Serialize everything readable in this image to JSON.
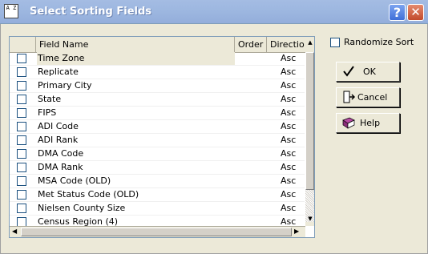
{
  "window": {
    "title": "Select Sorting Fields",
    "icon_text": "A Z",
    "help_button": "?",
    "close_button": "✕"
  },
  "table": {
    "headers": {
      "field": "Field Name",
      "order": "Order",
      "direction": "Directio"
    },
    "rows": [
      {
        "field": "Time Zone",
        "order": "",
        "direction": "Asc",
        "checked": false,
        "selected": true
      },
      {
        "field": "Replicate",
        "order": "",
        "direction": "Asc",
        "checked": false
      },
      {
        "field": "Primary City",
        "order": "",
        "direction": "Asc",
        "checked": false
      },
      {
        "field": "State",
        "order": "",
        "direction": "Asc",
        "checked": false
      },
      {
        "field": "FIPS",
        "order": "",
        "direction": "Asc",
        "checked": false
      },
      {
        "field": "ADI Code",
        "order": "",
        "direction": "Asc",
        "checked": false
      },
      {
        "field": "ADI Rank",
        "order": "",
        "direction": "Asc",
        "checked": false
      },
      {
        "field": "DMA Code",
        "order": "",
        "direction": "Asc",
        "checked": false
      },
      {
        "field": "DMA Rank",
        "order": "",
        "direction": "Asc",
        "checked": false
      },
      {
        "field": "MSA Code (OLD)",
        "order": "",
        "direction": "Asc",
        "checked": false
      },
      {
        "field": "Met Status Code (OLD)",
        "order": "",
        "direction": "Asc",
        "checked": false
      },
      {
        "field": "Nielsen County Size",
        "order": "",
        "direction": "Asc",
        "checked": false
      },
      {
        "field": "Census Region (4)",
        "order": "",
        "direction": "Asc",
        "checked": false
      }
    ]
  },
  "options": {
    "randomize_label": "Randomize Sort",
    "randomize_checked": false
  },
  "buttons": {
    "ok": "OK",
    "cancel": "Cancel",
    "help": "Help"
  },
  "icons": {
    "ok": "checkmark-icon",
    "cancel": "exit-door-icon",
    "help": "help-book-icon"
  },
  "colors": {
    "title_bar": "#9DB7E0",
    "dialog_bg": "#ECE9D8",
    "close_red": "#C24A2C",
    "help_book": "#8B2E7A"
  }
}
